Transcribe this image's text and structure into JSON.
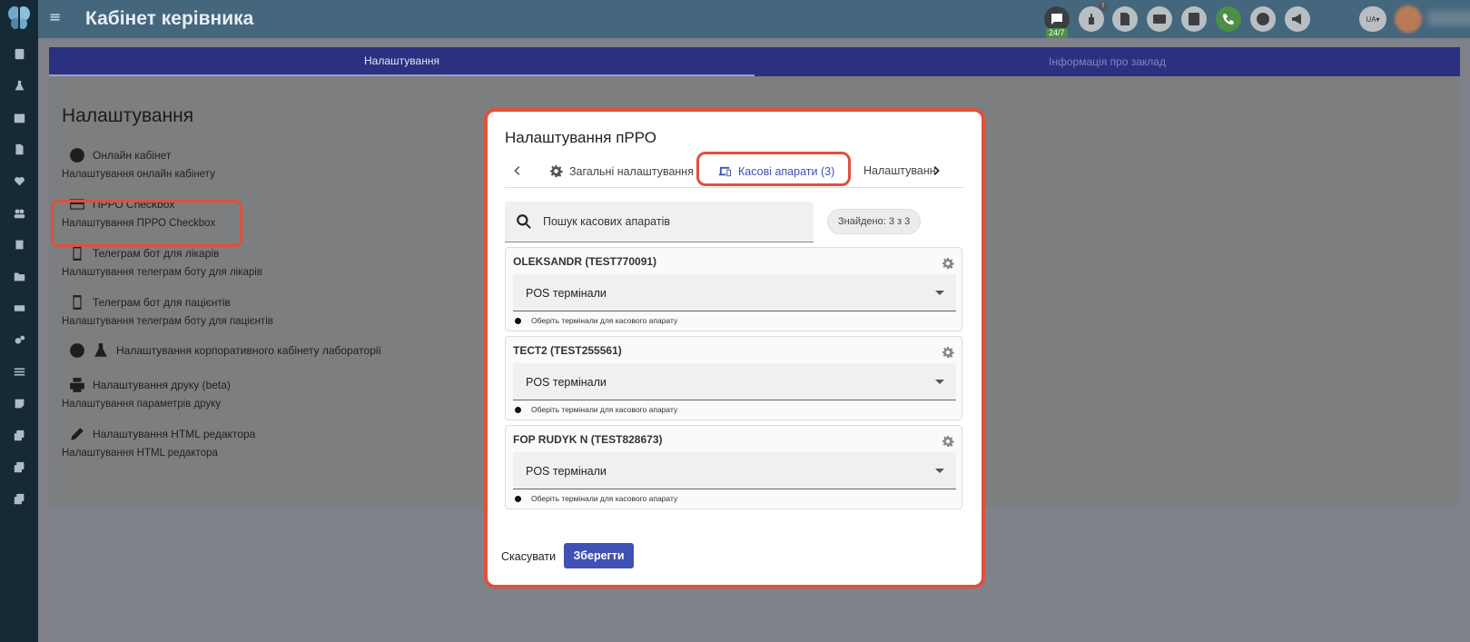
{
  "header": {
    "title": "Кабінет керівника",
    "support_badge": "24/7",
    "notification_count": "!",
    "language": "UA"
  },
  "tabs": [
    {
      "label": "Налаштування",
      "active": true
    },
    {
      "label": "Інформація про заклад",
      "active": false
    }
  ],
  "settings_page": {
    "title": "Налаштування",
    "items": [
      {
        "label": "Онлайн кабінет",
        "sub": "Налаштування онлайн кабінету",
        "icon": "globe-icon"
      },
      {
        "label": "ПРРО Checkbox",
        "sub": "Налаштування ПРРО Checkbox",
        "icon": "credit-card-icon"
      },
      {
        "label": "Телеграм бот для лікарів",
        "sub": "Налаштування телеграм боту для лікарів",
        "icon": "phone-link-icon"
      },
      {
        "label": "Телеграм бот для пацієнтів",
        "sub": "Налаштування телеграм боту для пацієнтів",
        "icon": "phone-link-icon"
      },
      {
        "label": "Налаштування корпоративного кабінету лабораторії",
        "sub": "",
        "icon": "globe-flask-icon"
      },
      {
        "label": "Налаштування друку (beta)",
        "sub": "Налаштування параметрів друку",
        "icon": "printer-icon"
      },
      {
        "label": "Налаштування HTML редактора",
        "sub": "Налаштування HTML редактора",
        "icon": "pencil-icon"
      }
    ]
  },
  "modal": {
    "title": "Налаштування пРРО",
    "tabs": [
      {
        "label": "Загальні налаштування",
        "icon": "gear-icon",
        "active": false
      },
      {
        "label": "Касові апарати (3)",
        "icon": "devices-icon",
        "active": true
      },
      {
        "label": "Налаштуванн",
        "icon": "",
        "active": false
      }
    ],
    "search": {
      "placeholder": "Пошук касових апаратів",
      "value": ""
    },
    "found": "Знайдено: 3 з 3",
    "registers": [
      {
        "name": "OLEKSANDR (TEST770091)",
        "select_label": "POS термінали",
        "hint": "Оберіть термінали для касового апарату"
      },
      {
        "name": "ТЕСТ2 (TEST255561)",
        "select_label": "POS термінали",
        "hint": "Оберіть термінали для касового апарату"
      },
      {
        "name": "FOP RUDYK N (TEST828673)",
        "select_label": "POS термінали",
        "hint": "Оберіть термінали для касового апарату"
      }
    ],
    "cancel_label": "Скасувати",
    "save_label": "Зберегти"
  },
  "colors": {
    "accent": "#3f51b5",
    "highlight": "#e0503a",
    "topbar": "#44677e",
    "rail": "#152a36"
  }
}
